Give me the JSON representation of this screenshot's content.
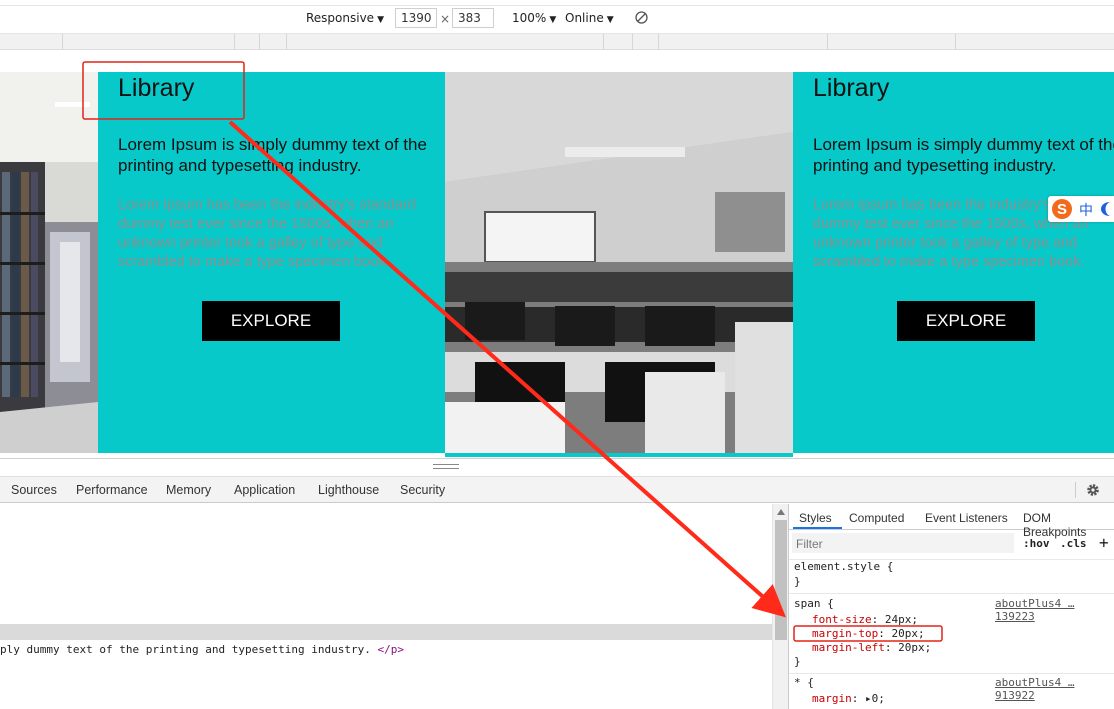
{
  "device_toolbar": {
    "mode_label": "Responsive",
    "width_value": "1390",
    "height_value": "383",
    "times": "×",
    "zoom_label": "100%",
    "network_label": "Online"
  },
  "viewport": {
    "panels": [
      {
        "title": "Library",
        "subtitle": "Lorem Ipsum is simply dummy text of the printing and typesetting industry.",
        "body": "Lorem Ipsum has been the industry's standard dummy test ever since the 1500s, when an unknown printer took a galley of type and scrambled to make a type specimen book.",
        "button": "EXPLORE"
      },
      {
        "title": "Library",
        "subtitle": "Lorem Ipsum is simply dummy text of the printing and typesetting industry.",
        "body": "Lorem Ipsum has been the industry's standard dummy test ever since the 1500s, when an unknown printer took a galley of type and scrambled to make a type specimen book.",
        "button": "EXPLORE"
      }
    ],
    "ime_char": "中",
    "ime_logo": "S",
    "colors": {
      "panel": "#07c9c9",
      "button": "#000000",
      "annotation": "#ff2a1a"
    }
  },
  "devtools": {
    "tabs": [
      "Sources",
      "Performance",
      "Memory",
      "Application",
      "Lighthouse",
      "Security"
    ],
    "elements": {
      "selected_line_prefix": "ply dummy text of the printing and typesetting industry. ",
      "selected_line_close": "</p>"
    },
    "styles": {
      "subtabs": [
        "Styles",
        "Computed",
        "Event Listeners",
        "DOM Breakpoints"
      ],
      "filter_placeholder": "Filter",
      "hov": ":hov",
      "cls": ".cls",
      "plus": "+",
      "element_style_open": "element.style {",
      "close_brace": "}",
      "rule1": {
        "selector": "span {",
        "source": "aboutPlus4 …139223",
        "props": [
          {
            "name": "font-size",
            "value": "24px;"
          },
          {
            "name": "margin-top",
            "value": "20px;"
          },
          {
            "name": "margin-left",
            "value": "20px;"
          }
        ]
      },
      "rule2": {
        "selector": "* {",
        "source": "aboutPlus4 …913922",
        "prop_name": "margin",
        "prop_value": "0;"
      }
    }
  }
}
